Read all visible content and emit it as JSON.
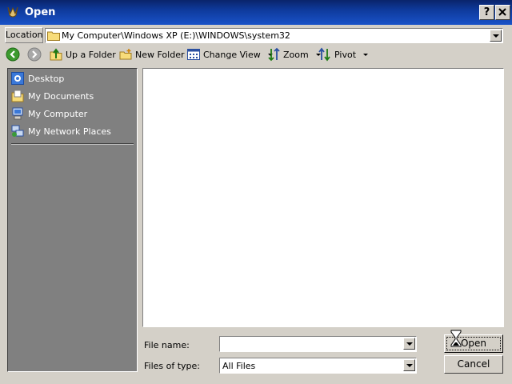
{
  "window": {
    "title": "Open"
  },
  "titlebar": {
    "help_label": "?",
    "close_label": "X"
  },
  "location": {
    "label": "Location",
    "path": "My Computer\\Windows XP (E:)\\WINDOWS\\system32"
  },
  "toolbar": {
    "up_folder": "Up a Folder",
    "new_folder": "New Folder",
    "change_view": "Change View",
    "zoom": "Zoom",
    "pivot": "Pivot"
  },
  "places": [
    {
      "label": "Desktop",
      "icon": "desktop-icon"
    },
    {
      "label": "My Documents",
      "icon": "my-documents-icon"
    },
    {
      "label": "My Computer",
      "icon": "my-computer-icon"
    },
    {
      "label": "My Network Places",
      "icon": "network-places-icon"
    }
  ],
  "form": {
    "file_name_label": "File name:",
    "file_name_value": "",
    "file_type_label": "Files of type:",
    "file_type_value": "All Files"
  },
  "buttons": {
    "open": "Open",
    "cancel": "Cancel"
  },
  "colors": {
    "titlebar": "#0a246a",
    "face": "#d4d0c8",
    "places_bg": "#808080"
  }
}
